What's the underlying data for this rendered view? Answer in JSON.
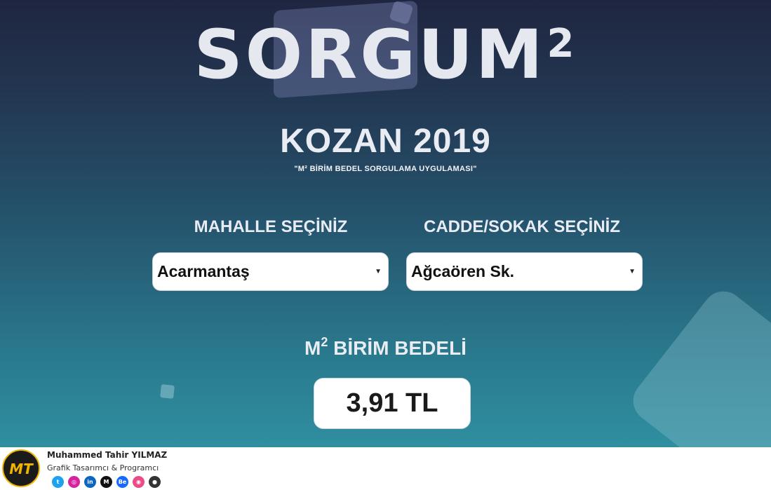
{
  "app": {
    "logo_text": "SORGUM",
    "logo_sup": "2",
    "title": "KOZAN 2019",
    "subtitle": "\"M² BİRİM BEDEL SORGULAMA UYGULAMASI\""
  },
  "form": {
    "neighborhood": {
      "label": "MAHALLE SEÇİNİZ",
      "selected": "Acarmantaş"
    },
    "street": {
      "label": "CADDE/SOKAK SEÇİNİZ",
      "selected": "Ağcaören Sk."
    }
  },
  "result": {
    "label_prefix": "M",
    "label_sup": "2",
    "label_suffix": " BİRİM BEDELİ",
    "value": "3,91 TL"
  },
  "footer": {
    "name": "Muhammed Tahir YILMAZ",
    "role": "Grafik Tasarımcı & Programcı",
    "avatar_monogram": "MT",
    "socials": [
      {
        "name": "twitter-icon",
        "glyph": "t",
        "color": "#1da1f2"
      },
      {
        "name": "instagram-icon",
        "glyph": "◎",
        "color": "#d6249f"
      },
      {
        "name": "linkedin-icon",
        "glyph": "in",
        "color": "#0a66c2"
      },
      {
        "name": "medium-icon",
        "glyph": "M",
        "color": "#111111"
      },
      {
        "name": "behance-icon",
        "glyph": "Be",
        "color": "#1769ff"
      },
      {
        "name": "dribbble-icon",
        "glyph": "◉",
        "color": "#ea4c89"
      },
      {
        "name": "github-icon",
        "glyph": "●",
        "color": "#333333"
      }
    ]
  },
  "colors": {
    "bg_top": "#1f2540",
    "bg_bottom": "#2f8fa0",
    "heading": "#e9ecf3",
    "avatar_ring": "#f0b400"
  }
}
